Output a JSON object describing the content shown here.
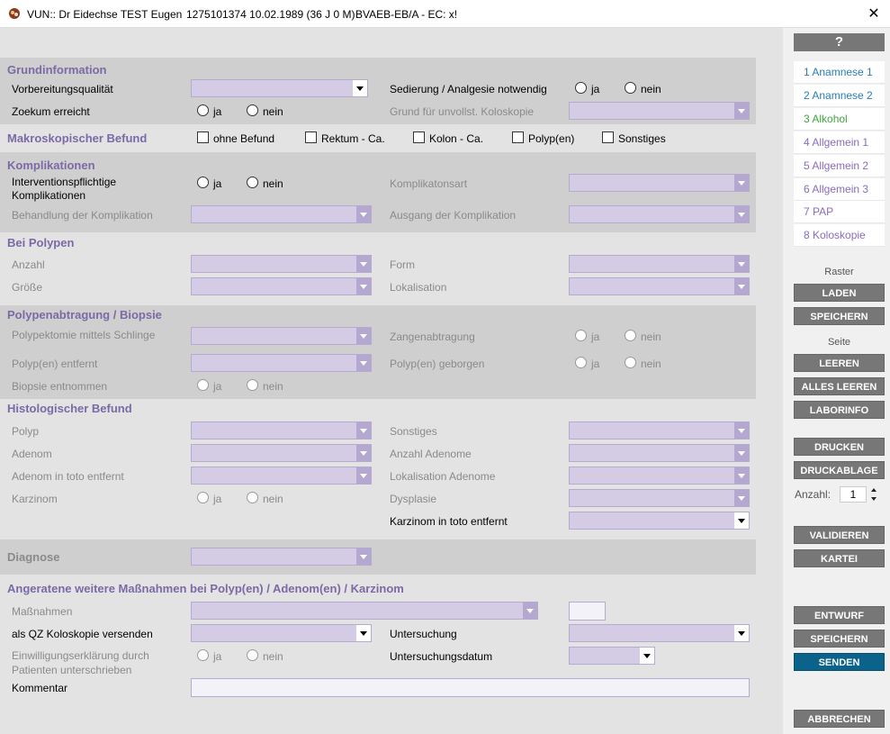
{
  "title": {
    "app": "VUN:: Dr Eidechse TEST Eugen",
    "patient": "1275101374 10.02.1989 (36 J 0 M)",
    "kasse": "BVAEB-EB/A - EC: x!",
    "close": "✕"
  },
  "radio": {
    "ja": "ja",
    "nein": "nein"
  },
  "grund": {
    "heading": "Grundinformation",
    "vorbereitung": "Vorbereitungsqualität",
    "sedierung": "Sedierung / Analgesie notwendig",
    "zoekum": "Zoekum erreicht",
    "grund_unvollst": "Grund für unvollst. Koloskopie"
  },
  "makro": {
    "heading": "Makroskopischer Befund",
    "options": [
      "ohne Befund",
      "Rektum - Ca.",
      "Kolon - Ca.",
      "Polyp(en)",
      "Sonstiges"
    ]
  },
  "kompl": {
    "heading": "Komplikationen",
    "interv": "Interventionspflichtige Komplikationen",
    "art": "Komplikatonsart",
    "behandlung": "Behandlung der Komplikation",
    "ausgang": "Ausgang der Komplikation"
  },
  "polypen": {
    "heading": "Bei Polypen",
    "anzahl": "Anzahl",
    "form": "Form",
    "groesse": "Größe",
    "lokalisation": "Lokalisation"
  },
  "abtragung": {
    "heading": "Polypenabtragung / Biopsie",
    "schlinge": "Polypektomie mittels Schlinge",
    "zange": "Zangenabtragung",
    "entfernt": "Polyp(en) entfernt",
    "geborgen": "Polyp(en) geborgen",
    "biopsie": "Biopsie entnommen"
  },
  "histo": {
    "heading": "Histologischer Befund",
    "polyp": "Polyp",
    "sonstiges": "Sonstiges",
    "adenom": "Adenom",
    "anzahl_adenome": "Anzahl Adenome",
    "adenom_toto": "Adenom in toto entfernt",
    "lok_adenome": "Lokalisation Adenome",
    "karzinom": "Karzinom",
    "dysplasie": "Dysplasie",
    "karzinom_toto": "Karzinom in toto entfernt"
  },
  "diagnose": {
    "heading": "Diagnose"
  },
  "massnahmen": {
    "heading": "Angeratene weitere Maßnahmen bei Polyp(en) / Adenom(en) / Karzinom",
    "massnahmen": "Maßnahmen",
    "qz": "als QZ Koloskopie versenden",
    "untersuchung": "Untersuchung",
    "einwilligung": "Einwilligungserklärung durch Patienten unterschrieben",
    "datum": "Untersuchungsdatum",
    "kommentar": "Kommentar"
  },
  "sidebar": {
    "help": "?",
    "nav": [
      {
        "label": "1 Anamnese 1",
        "color": "#2a7cb5"
      },
      {
        "label": "2 Anamnese 2",
        "color": "#2a7cb5"
      },
      {
        "label": "3 Alkohol",
        "color": "#3fa63f"
      },
      {
        "label": "4 Allgemein 1",
        "color": "#8a6cb8"
      },
      {
        "label": "5 Allgemein 2",
        "color": "#8a6cb8"
      },
      {
        "label": "6 Allgemein 3",
        "color": "#8a6cb8"
      },
      {
        "label": "7 PAP",
        "color": "#8a6cb8"
      },
      {
        "label": "8 Koloskopie",
        "color": "#8a6cb8"
      }
    ],
    "raster": "Raster",
    "laden": "LADEN",
    "speichern1": "SPEICHERN",
    "seite": "Seite",
    "leeren": "LEEREN",
    "alles_leeren": "ALLES LEEREN",
    "laborinfo": "LABORINFO",
    "drucken": "DRUCKEN",
    "druckablage": "DRUCKABLAGE",
    "anzahl_label": "Anzahl:",
    "anzahl_value": "1",
    "validieren": "VALIDIEREN",
    "kartei": "KARTEI",
    "entwurf": "ENTWURF",
    "speichern2": "SPEICHERN",
    "senden": "SENDEN",
    "abbrechen": "ABBRECHEN"
  }
}
